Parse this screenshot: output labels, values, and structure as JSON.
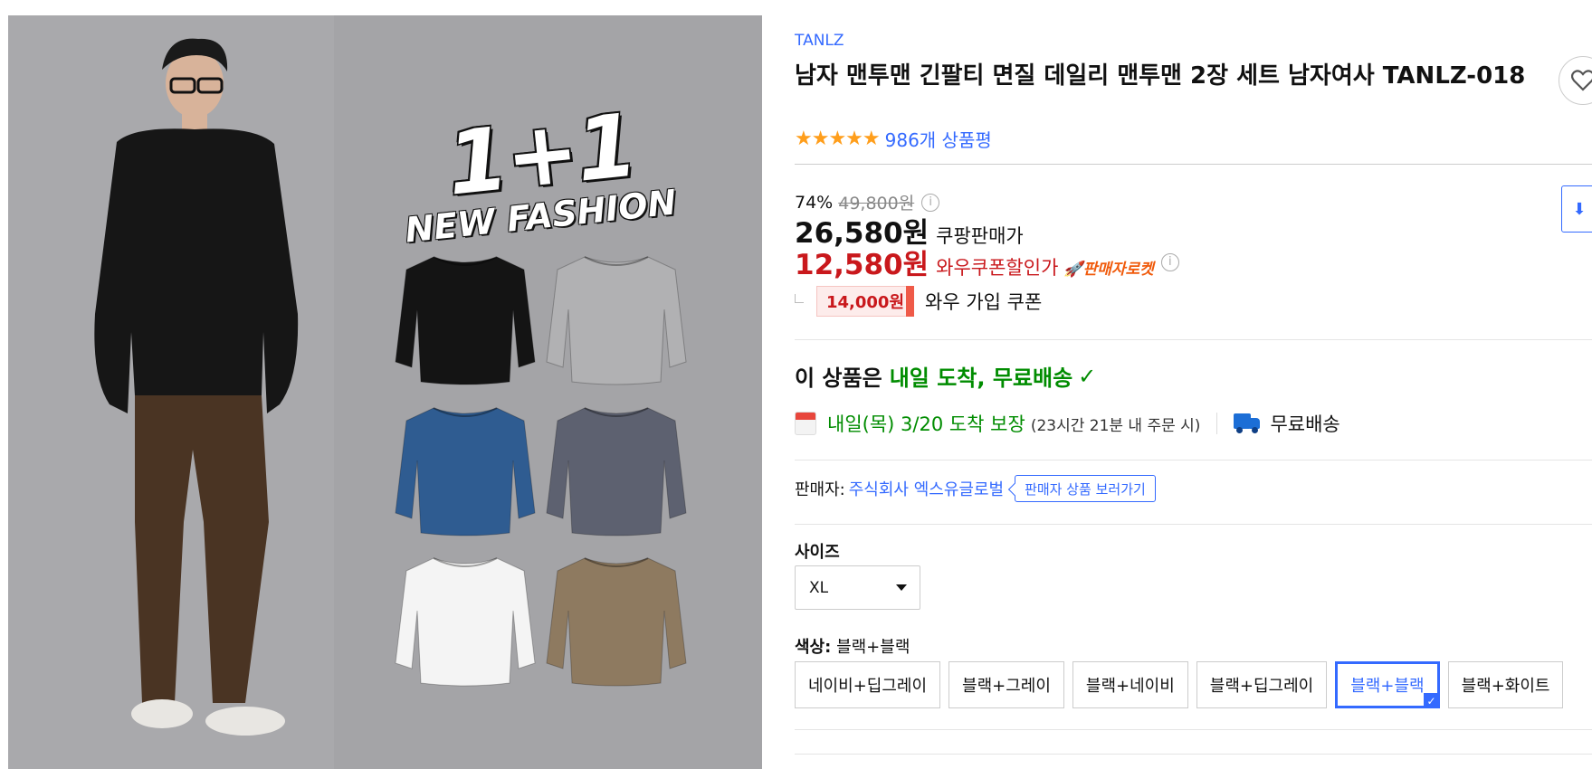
{
  "gallery": {
    "promo_line1": "1+1",
    "promo_line2": "NEW FASHION",
    "sweatshirt_colors": [
      "#141414",
      "#b1b1b3",
      "#2f5c91",
      "#5d6170",
      "#f4f4f4",
      "#8e7a60"
    ],
    "model_colors": {
      "top": "#161616",
      "pants": "#4a3423",
      "shoes": "#e8e6e2",
      "skin": "#d8b39a"
    }
  },
  "product": {
    "brand": "TANLZ",
    "title": "남자 맨투맨 긴팔티 면질 데일리 맨투맨 2장 세트 남자여사 TANLZ-018",
    "rating_stars": 5,
    "stars_glyph": "★★★★★",
    "review_count": "986개 상품평"
  },
  "price": {
    "discount_rate": "74%",
    "original_price": "49,800원",
    "sale_price": "26,580원",
    "sale_label": "쿠팡판매가",
    "coupon_price": "12,580원",
    "coupon_label": "와우쿠폰할인가",
    "rocket_badge": "🚀판매자로켓",
    "join_coupon_amount": "14,000원",
    "join_coupon_label": "와우 가입 쿠폰"
  },
  "delivery": {
    "head_prefix": "이 상품은",
    "head_highlight": "내일 도착, 무료배송",
    "arrive_date": "내일(목) 3/20 도착 보장",
    "order_within": "(23시간 21분 내 주문 시)",
    "free_shipping": "무료배송"
  },
  "seller": {
    "label": "판매자:",
    "name": "주식회사 엑스유글로벌",
    "link": "판매자 상품 보러가기"
  },
  "options": {
    "size_label": "사이즈",
    "size_value": "XL",
    "color_label": "색상:",
    "color_value": "블랙+블랙",
    "colors": [
      {
        "label": "네이비+딥그레이",
        "selected": false
      },
      {
        "label": "블랙+그레이",
        "selected": false
      },
      {
        "label": "블랙+네이비",
        "selected": false
      },
      {
        "label": "블랙+딥그레이",
        "selected": false
      },
      {
        "label": "블랙+블랙",
        "selected": true
      },
      {
        "label": "블랙+화이트",
        "selected": false
      }
    ]
  },
  "colors": {
    "accent": "#346aff",
    "sale_red": "#c9181c",
    "delivery_green": "#008c00",
    "star_orange": "#ff9e1b"
  }
}
